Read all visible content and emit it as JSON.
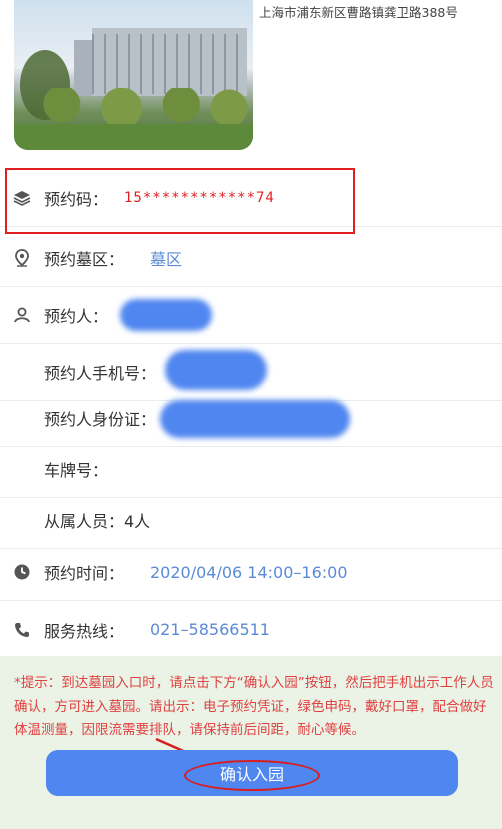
{
  "header": {
    "address": "上海市浦东新区曹路镇龚卫路388号"
  },
  "details": {
    "reservation_code_label": "预约码：",
    "reservation_code_value": "15************74",
    "cemetery_area_label": "预约墓区：",
    "cemetery_area_value": "墓区",
    "booker_label": "预约人：",
    "phone_label": "预约人手机号：",
    "id_label": "预约人身份证：",
    "plate_label": "车牌号：",
    "companions_label": "从属人员：",
    "companions_value": "4人",
    "time_label": "预约时间：",
    "time_value": "2020/04/06 14:00–16:00",
    "hotline_label": "服务热线：",
    "hotline_value": "021–58566511"
  },
  "tip": {
    "text": "*提示：到达墓园入口时，请点击下方“确认入园”按钮，然后把手机出示工作人员确认，方可进入墓园。请出示：电子预约凭证，绿色申码，戴好口罩，配合做好体温测量，因限流需要排队，请保持前后间距，耐心等候。"
  },
  "actions": {
    "confirm_label": "确认入园"
  },
  "colors": {
    "accent": "#4f86f0",
    "value_text": "#5b8bd6",
    "tip_text": "#e04040",
    "tip_bg": "#eaf3e6",
    "highlight": "#e02020"
  },
  "icons": [
    "layers-icon",
    "location-pin-icon",
    "person-icon",
    "clock-icon",
    "phone-icon"
  ]
}
